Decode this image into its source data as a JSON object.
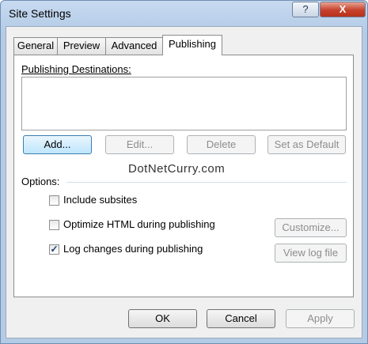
{
  "window": {
    "title": "Site Settings",
    "help_glyph": "?",
    "close_glyph": "X"
  },
  "tabs": [
    {
      "label": "General"
    },
    {
      "label": "Preview"
    },
    {
      "label": "Advanced"
    },
    {
      "label": "Publishing",
      "active": true
    }
  ],
  "publishing": {
    "destinations_label": "Publishing Destinations:",
    "add_label": "Add...",
    "edit_label": "Edit...",
    "delete_label": "Delete",
    "set_default_label": "Set as Default"
  },
  "watermark": "DotNetCurry.com",
  "options": {
    "label": "Options:",
    "include_subsites": {
      "label": "Include subsites",
      "checked": false
    },
    "optimize_html": {
      "label": "Optimize HTML during publishing",
      "checked": false
    },
    "log_changes": {
      "label": "Log changes during publishing",
      "checked": true
    },
    "customize_label": "Customize...",
    "view_log_label": "View log file"
  },
  "footer": {
    "ok_label": "OK",
    "cancel_label": "Cancel",
    "apply_label": "Apply"
  },
  "colors": {
    "accent_border": "#3c7fb1",
    "disabled_text": "#8d8d8d",
    "close_red": "#c6412b"
  }
}
